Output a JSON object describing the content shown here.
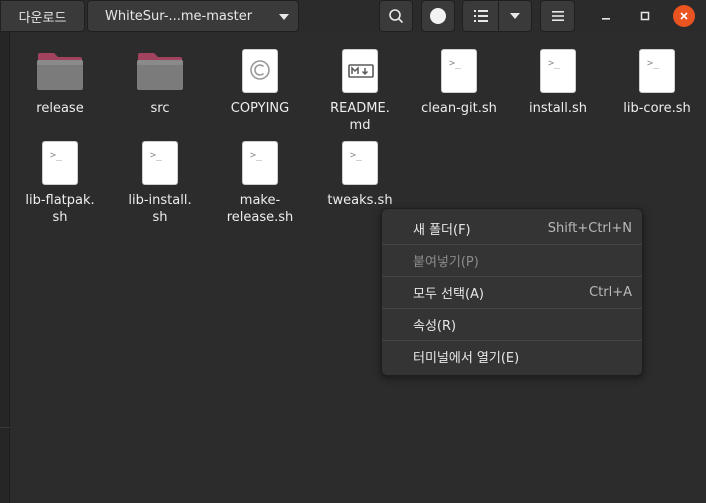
{
  "header": {
    "breadcrumbs": [
      "다운로드",
      "WhiteSur-...me-master"
    ]
  },
  "files": [
    {
      "name": "release",
      "kind": "folder"
    },
    {
      "name": "src",
      "kind": "folder"
    },
    {
      "name": "COPYING",
      "kind": "copyright"
    },
    {
      "name": "README.\nmd",
      "kind": "markdown"
    },
    {
      "name": "clean-git.sh",
      "kind": "script"
    },
    {
      "name": "install.sh",
      "kind": "script"
    },
    {
      "name": "lib-core.sh",
      "kind": "script"
    },
    {
      "name": "lib-flatpak.\nsh",
      "kind": "script"
    },
    {
      "name": "lib-install.\nsh",
      "kind": "script"
    },
    {
      "name": "make-\nrelease.sh",
      "kind": "script"
    },
    {
      "name": "tweaks.sh",
      "kind": "script"
    }
  ],
  "context_menu": {
    "items": [
      {
        "label": "새 폴더(F)",
        "accel": "Shift+Ctrl+N",
        "enabled": true
      },
      {
        "label": "붙여넣기(P)",
        "accel": "",
        "enabled": false
      },
      {
        "label": "모두 선택(A)",
        "accel": "Ctrl+A",
        "enabled": true
      },
      {
        "label": "속성(R)",
        "accel": "",
        "enabled": true
      },
      {
        "label": "터미널에서 열기(E)",
        "accel": "",
        "enabled": true
      }
    ]
  },
  "colors": {
    "accent": "#e95420",
    "background": "#2c2c2c",
    "menu_bg": "#343434"
  },
  "icons": [
    "search-icon",
    "view-toggle-icon",
    "list-view-icon",
    "chevron-down-icon",
    "hamburger-menu-icon",
    "minimize-icon",
    "maximize-icon",
    "close-icon"
  ]
}
